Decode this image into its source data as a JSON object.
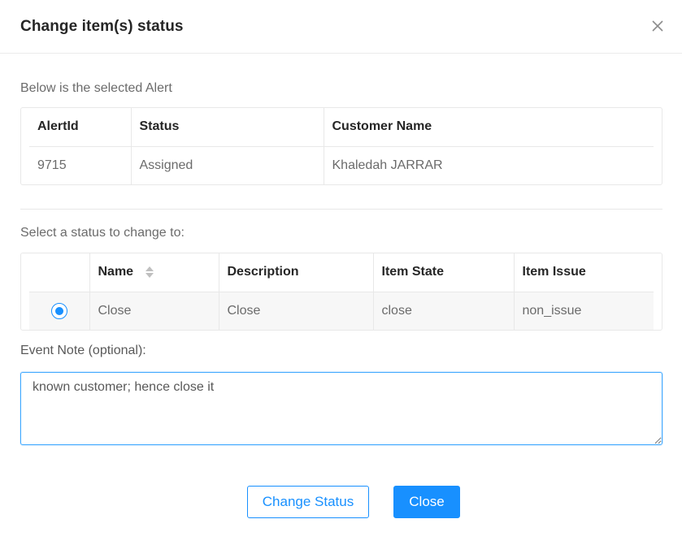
{
  "modal": {
    "title": "Change item(s) status",
    "close_icon": "close-icon"
  },
  "alert_section": {
    "label": "Below is the selected Alert",
    "columns": [
      "AlertId",
      "Status",
      "Customer Name"
    ],
    "rows": [
      {
        "alert_id": "9715",
        "status": "Assigned",
        "customer_name": "Khaledah JARRAR"
      }
    ]
  },
  "status_section": {
    "label": "Select a status to change to:",
    "columns": [
      "",
      "Name",
      "Description",
      "Item State",
      "Item Issue"
    ],
    "sort_icon": "sort-icon",
    "rows": [
      {
        "selected": true,
        "name": "Close",
        "description": "Close",
        "item_state": "close",
        "item_issue": "non_issue"
      }
    ]
  },
  "event_note": {
    "label": "Event Note (optional):",
    "value": "known customer; hence close it"
  },
  "buttons": {
    "change_status": "Change Status",
    "close": "Close"
  },
  "colors": {
    "primary": "#1890ff",
    "border": "#e8e8e8"
  }
}
